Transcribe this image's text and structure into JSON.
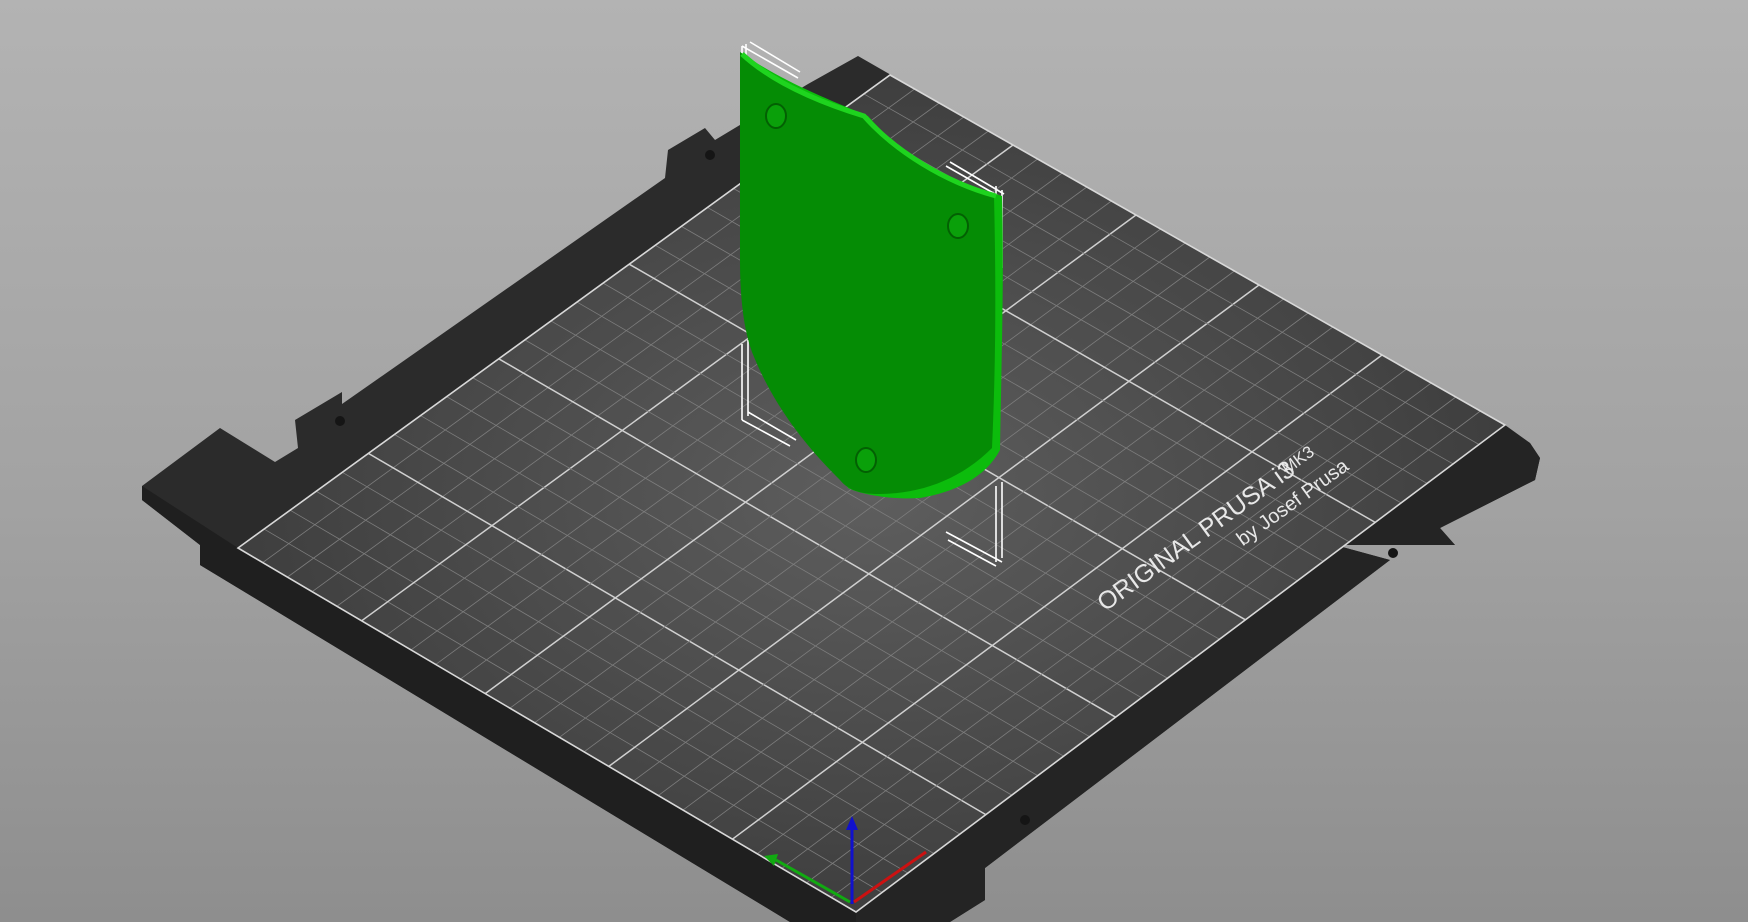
{
  "bed": {
    "brand_line": "ORIGINAL PRUSA i3",
    "model": "MK3",
    "maker": "by Josef Prusa"
  },
  "object": {
    "color": "#0a9a0a",
    "selected": true
  },
  "axes": {
    "x_color": "#cc1111",
    "y_color": "#11aa11",
    "z_color": "#1111cc"
  },
  "colors": {
    "background_top": "#b3b3b3",
    "background_bottom": "#8e8e8e",
    "bed_frame": "#2e2e2e",
    "bed_surface": "#4a4a4a",
    "grid_line": "#9a9a9a",
    "bounding_box": "#ffffff"
  }
}
